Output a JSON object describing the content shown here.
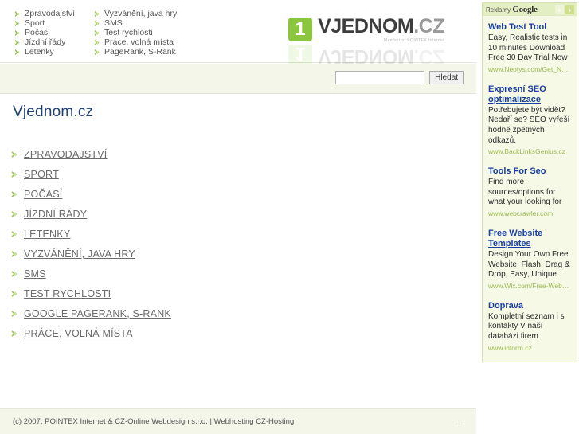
{
  "topnav": {
    "column1": [
      {
        "label": "Zpravodajství"
      },
      {
        "label": "Sport"
      },
      {
        "label": "Počasí"
      },
      {
        "label": "Jízdní řády"
      },
      {
        "label": "Letenky"
      }
    ],
    "column2": [
      {
        "label": "Vyzvánění, java hry"
      },
      {
        "label": "SMS"
      },
      {
        "label": "Test rychlosti"
      },
      {
        "label": "Práce, volná místa"
      },
      {
        "label": "PageRank, S-Rank"
      }
    ]
  },
  "logo": {
    "badge": "1",
    "name": "VJEDNOM",
    "tld": ".CZ",
    "tagline": "Member of POINTEX Internet"
  },
  "search": {
    "value": "",
    "placeholder": "",
    "button_label": "Hledat"
  },
  "main": {
    "title": "Vjednom.cz",
    "links": [
      {
        "label": "ZPRAVODAJSTVÍ"
      },
      {
        "label": "SPORT"
      },
      {
        "label": "POČASÍ"
      },
      {
        "label": "JÍZDNÍ ŘÁDY"
      },
      {
        "label": "LETENKY"
      },
      {
        "label": "VYZVÁNĚNÍ, JAVA HRY"
      },
      {
        "label": "SMS"
      },
      {
        "label": "TEST RYCHLOSTI"
      },
      {
        "label": "GOOGLE PAGERANK, S-RANK"
      },
      {
        "label": "PRÁCE, VOLNÁ MÍSTA"
      }
    ]
  },
  "footer": {
    "text": "(c) 2007, POINTEX Internet & CZ-Online Webdesign s.r.o.  |  Webhosting CZ-Hosting",
    "dots": "..."
  },
  "ads": {
    "header_prefix": "Reklamy ",
    "header_brand": "Google",
    "prev_icon": "‹",
    "next_icon": "›",
    "items": [
      {
        "title_line1": "Web Test Tool",
        "title_line2": "",
        "desc": "Easy, Realistic tests in 10 minutes Download Free 30 Day Trial Now",
        "url": "www.Neotys.com/Get_NeoLoad"
      },
      {
        "title_line1": "Expresní SEO",
        "title_line2": "optimalizace",
        "desc": "Potřebujete být vidět? Nedaří se? SEO vyřeší hodně zpětných odkazů.",
        "url": "www.BackLinksGenius.cz"
      },
      {
        "title_line1": "Tools For Seo",
        "title_line2": "",
        "desc": "Find more sources/options for what your looking for",
        "url": "www.webcrawler.com"
      },
      {
        "title_line1": "Free Website",
        "title_line2": "Templates",
        "desc": "Design Your Own Free Website. Flash, Drag & Drop, Easy, Unique",
        "url": "www.Wix.com/Free-Website-Te..."
      },
      {
        "title_line1": "Doprava",
        "title_line2": "",
        "desc": "Kompletní seznam i s kontakty V naší databázi firem",
        "url": "www.inform.cz"
      }
    ]
  },
  "colors": {
    "accent_green": "#8cc63e",
    "band_cream": "#f3f6e9",
    "ads_bg": "#f5f9e6",
    "title_blue": "#1f3f73",
    "ad_link_blue": "#1a3fa0",
    "ad_url_green": "#9bb84c"
  }
}
